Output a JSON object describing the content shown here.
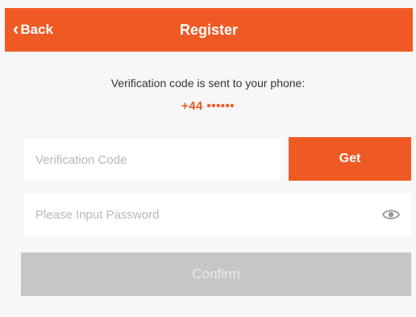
{
  "nav": {
    "back_label": "Back",
    "back_chevron": "‹",
    "title": "Register"
  },
  "info": {
    "message": "Verification code is sent to your phone:",
    "phone": "+44 ••••••"
  },
  "code": {
    "placeholder": "Verification Code",
    "value": "",
    "get_button_label": "Get"
  },
  "password": {
    "placeholder": "Please Input Password",
    "value": "",
    "toggle_icon": "eye-icon"
  },
  "confirm": {
    "label": "Confirm"
  },
  "colors": {
    "accent": "#ef5a24",
    "disabled_button": "#c6c6c6",
    "background": "#f7f7f7"
  }
}
